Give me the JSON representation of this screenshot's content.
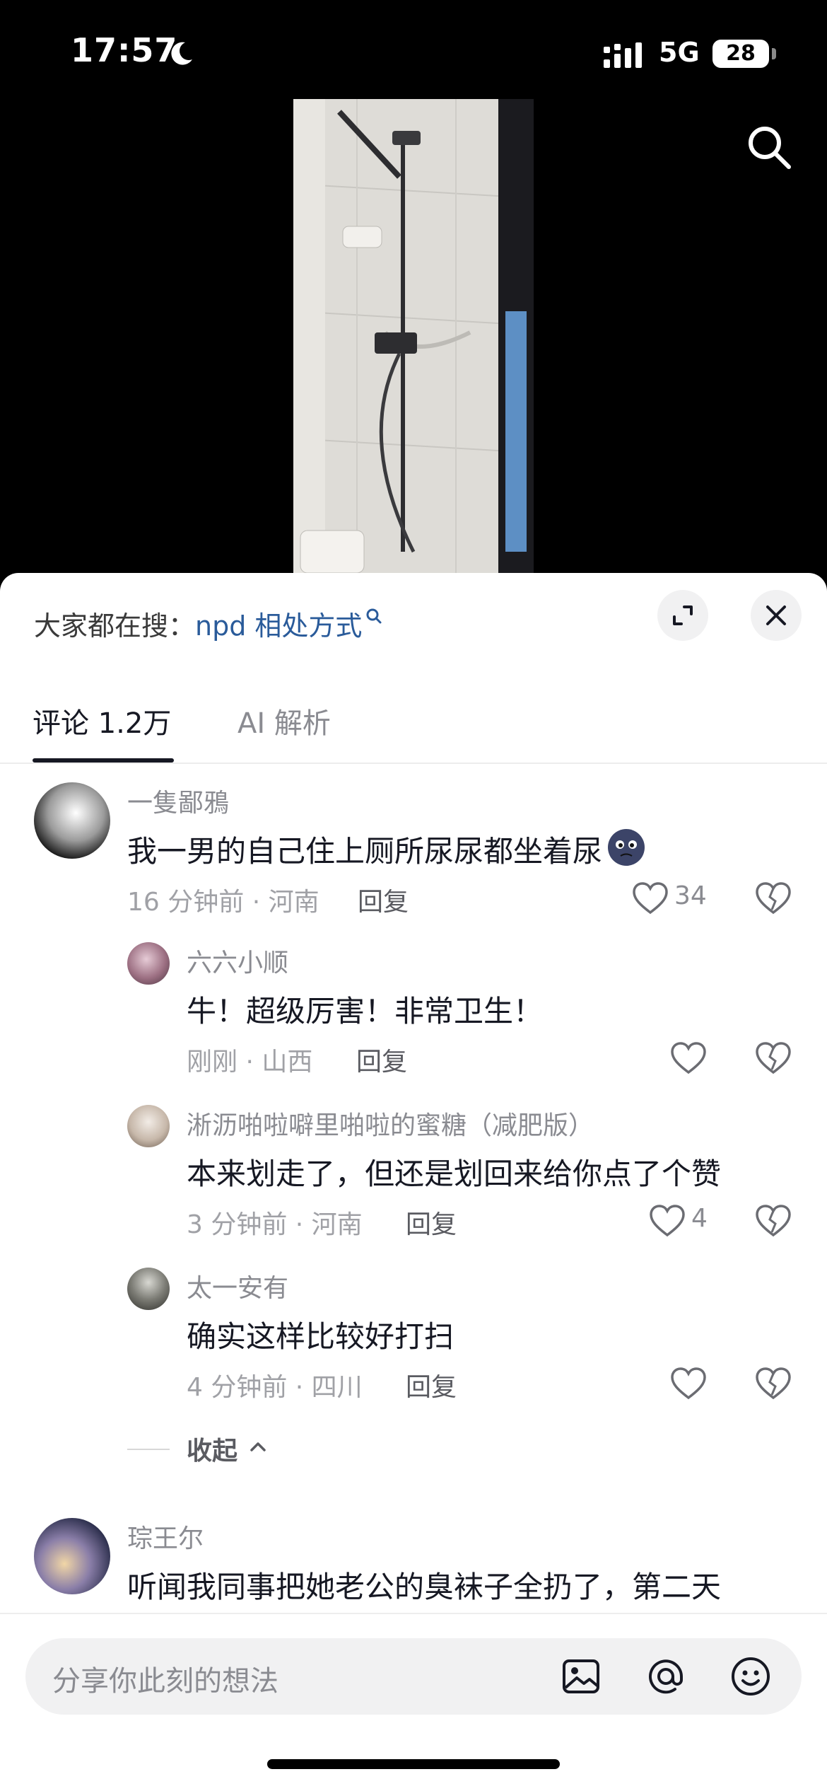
{
  "status_bar": {
    "time": "17:57",
    "network": "5G",
    "battery": "28"
  },
  "hot_search": {
    "label": "大家都在搜：",
    "term": "npd 相处方式"
  },
  "tabs": [
    {
      "label": "评论 1.2万",
      "active": true
    },
    {
      "label": "AI 解析",
      "active": false
    }
  ],
  "comments": [
    {
      "user": "一隻鄙鴉",
      "text": "我一男的自己住上厕所尿尿都坐着尿",
      "emoji_icon": "dark-face-emoji-icon",
      "meta": "16 分钟前 · 河南",
      "reply": "回复",
      "likes": "34"
    },
    {
      "user": "六六小顺",
      "text": "牛！超级厉害！非常卫生！",
      "meta": "刚刚 · 山西",
      "reply": "回复",
      "likes": ""
    },
    {
      "user": "淅沥啪啦噼里啪啦的蜜糖（减肥版）",
      "text": "本来划走了，但还是划回来给你点了个赞",
      "meta": "3 分钟前 · 河南",
      "reply": "回复",
      "likes": "4"
    },
    {
      "user": "太一安有",
      "text": "确实这样比较好打扫",
      "meta": "4 分钟前 · 四川",
      "reply": "回复",
      "likes": ""
    },
    {
      "user": "琮王尔",
      "text": "听闻我同事把她老公的臭袜子全扔了，第二天"
    }
  ],
  "collapse_label": "收起",
  "input": {
    "placeholder": "分享你此刻的想法"
  },
  "colors": {
    "accent_link": "#2a5b9a",
    "text_primary": "#161823",
    "text_secondary": "#8a8b91"
  }
}
